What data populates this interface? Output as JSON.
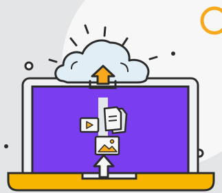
{
  "illustration": {
    "subject": "cloud-upload-laptop",
    "icons": [
      "cloud-icon",
      "upload-arrow-icon",
      "video-file-icon",
      "document-icon",
      "image-file-icon",
      "laptop-icon"
    ]
  },
  "colors": {
    "background": "#e4e5e6",
    "circle": "#f7f7f7",
    "cloud": "#e1eef5",
    "screen": "#7a3ef0",
    "accent_orange": "#f7a81c",
    "outline": "#2b2b2b",
    "laptop_body": "#f0f1f3",
    "base_yellow": "#f7b500",
    "file_gray": "#e4e7ea"
  }
}
